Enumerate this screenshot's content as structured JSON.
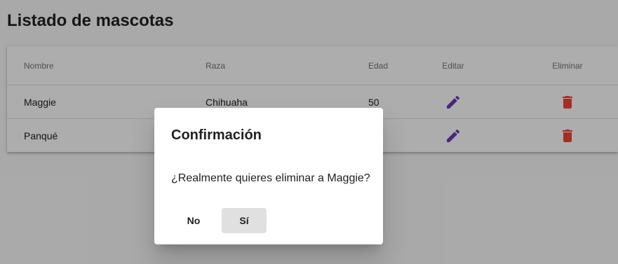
{
  "page": {
    "title": "Listado de mascotas"
  },
  "table": {
    "columns": [
      "Nombre",
      "Raza",
      "Edad",
      "Editar",
      "Eliminar"
    ],
    "rows": [
      {
        "name": "Maggie",
        "breed": "Chihuaha",
        "age": "50"
      },
      {
        "name": "Panqué",
        "breed": "",
        "age": ""
      }
    ]
  },
  "icons": {
    "edit": "edit-pencil-icon",
    "delete": "delete-trash-icon"
  },
  "colors": {
    "edit_icon": "#673ab7",
    "delete_icon": "#f44336"
  },
  "dialog": {
    "title": "Confirmación",
    "message": "¿Realmente quieres eliminar a Maggie?",
    "no_label": "No",
    "yes_label": "Sí"
  }
}
